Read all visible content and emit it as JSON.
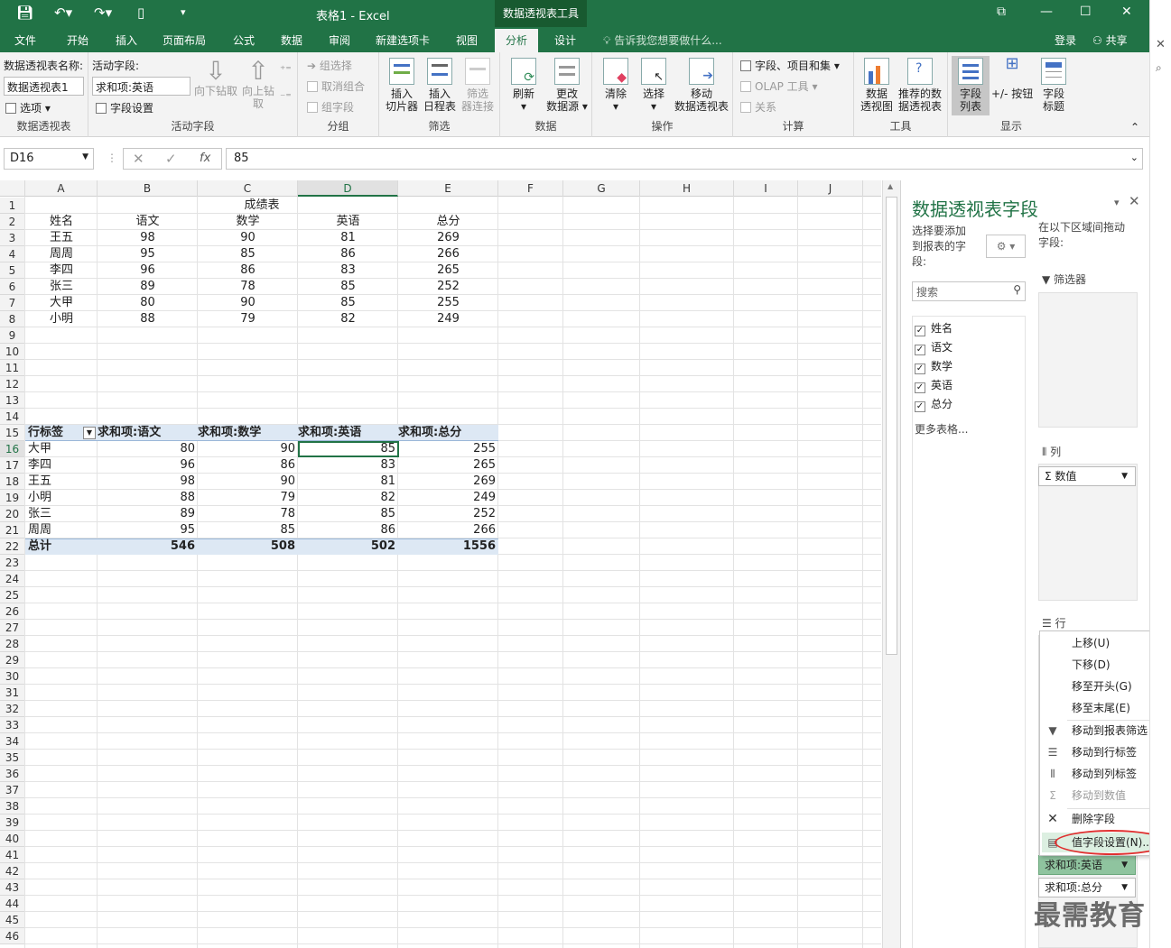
{
  "window": {
    "title": "表格1 - Excel",
    "context_tab_group": "数据透视表工具",
    "login": "登录",
    "share": "共享",
    "tell_me": "告诉我您想要做什么...",
    "colors": {
      "accent": "#217346",
      "pivot_band": "#dde8f4",
      "menu_highlight": "#dcefe1",
      "annotation": "#e03030"
    }
  },
  "ribbon_tabs": [
    "文件",
    "开始",
    "插入",
    "页面布局",
    "公式",
    "数据",
    "审阅",
    "新建选项卡",
    "视图",
    "分析",
    "设计"
  ],
  "active_tab": "分析",
  "ribbon": {
    "g_pivot": {
      "name_label": "数据透视表名称:",
      "name_value": "数据透视表1",
      "options": "选项",
      "label": "数据透视表"
    },
    "g_active": {
      "field_label": "活动字段:",
      "field_value": "求和项:英语",
      "field_settings": "字段设置",
      "drill_down": "向下钻取",
      "drill_up": "向上钻",
      "drill_up2": "取",
      "label": "活动字段"
    },
    "g_group": {
      "group_selection": "组选择",
      "ungroup": "取消组合",
      "group_field": "组字段",
      "label": "分组"
    },
    "g_filter": {
      "insert_slicer": [
        "插入",
        "切片器"
      ],
      "insert_timeline": [
        "插入",
        "日程表"
      ],
      "filter_connections": [
        "筛选",
        "器连接"
      ],
      "label": "筛选"
    },
    "g_data": {
      "refresh": "刷新",
      "change_source": [
        "更改",
        "数据源"
      ],
      "label": "数据"
    },
    "g_actions": {
      "clear": "清除",
      "select": "选择",
      "move": [
        "移动",
        "数据透视表"
      ],
      "label": "操作"
    },
    "g_calc": {
      "fields_items": "字段、项目和集",
      "olap": "OLAP 工具",
      "relations": "关系",
      "label": "计算"
    },
    "g_tools": {
      "pivot_chart": [
        "数据",
        "透视图"
      ],
      "recommended": [
        "推荐的数",
        "据透视表"
      ],
      "label": "工具"
    },
    "g_show": {
      "field_list": [
        "字段",
        "列表"
      ],
      "buttons": "+/- 按钮",
      "headers": [
        "字段",
        "标题"
      ],
      "label": "显示"
    }
  },
  "formula_bar": {
    "name_box": "D16",
    "fx": "fx",
    "formula": "85"
  },
  "columns": [
    "A",
    "B",
    "C",
    "D",
    "E",
    "F",
    "G",
    "H",
    "I",
    "J"
  ],
  "selected_column": "D",
  "selected_row": 16,
  "rows": [
    "1",
    "2",
    "3",
    "4",
    "5",
    "6",
    "7",
    "8",
    "9",
    "10",
    "11",
    "12",
    "13",
    "14",
    "15",
    "16",
    "17",
    "18",
    "19",
    "20",
    "21",
    "22",
    "23",
    "24",
    "25",
    "26",
    "27",
    "28",
    "29",
    "30",
    "31",
    "32",
    "33",
    "34",
    "35",
    "36",
    "37",
    "38",
    "39",
    "40",
    "41",
    "42",
    "43",
    "44",
    "45",
    "46"
  ],
  "source_table": {
    "title": "成绩表",
    "headers": [
      "姓名",
      "语文",
      "数学",
      "英语",
      "总分"
    ],
    "rows": [
      [
        "王五",
        "98",
        "90",
        "81",
        "269"
      ],
      [
        "周周",
        "95",
        "85",
        "86",
        "266"
      ],
      [
        "李四",
        "96",
        "86",
        "83",
        "265"
      ],
      [
        "张三",
        "89",
        "78",
        "85",
        "252"
      ],
      [
        "大甲",
        "80",
        "90",
        "85",
        "255"
      ],
      [
        "小明",
        "88",
        "79",
        "82",
        "249"
      ]
    ]
  },
  "pivot_table": {
    "headers": [
      "行标签",
      "求和项:语文",
      "求和项:数学",
      "求和项:英语",
      "求和项:总分"
    ],
    "rows": [
      [
        "大甲",
        "80",
        "90",
        "85",
        "255"
      ],
      [
        "李四",
        "96",
        "86",
        "83",
        "265"
      ],
      [
        "王五",
        "98",
        "90",
        "81",
        "269"
      ],
      [
        "小明",
        "88",
        "79",
        "82",
        "249"
      ],
      [
        "张三",
        "89",
        "78",
        "85",
        "252"
      ],
      [
        "周周",
        "95",
        "85",
        "86",
        "266"
      ]
    ],
    "total": [
      "总计",
      "546",
      "508",
      "502",
      "1556"
    ]
  },
  "field_pane": {
    "title": "数据透视表字段",
    "choose_text": [
      "选择要添加",
      "到报表的字",
      "段:"
    ],
    "drag_text": [
      "在以下区域间拖动",
      "字段:"
    ],
    "search_placeholder": "搜索",
    "fields": [
      "姓名",
      "语文",
      "数学",
      "英语",
      "总分"
    ],
    "more_tables": "更多表格...",
    "filters_label": "筛选器",
    "columns_label": "列",
    "rows_label": "行",
    "values_chip": "Σ 数值",
    "value_chip_english": "求和项:英语",
    "value_chip_total": "求和项:总分"
  },
  "context_menu": {
    "items": [
      "上移(U)",
      "下移(D)",
      "移至开头(G)",
      "移至末尾(E)",
      "移动到报表筛选",
      "移动到行标签",
      "移动到列标签",
      "移动到数值",
      "删除字段",
      "值字段设置(N)..."
    ]
  },
  "watermark": "最需教育"
}
